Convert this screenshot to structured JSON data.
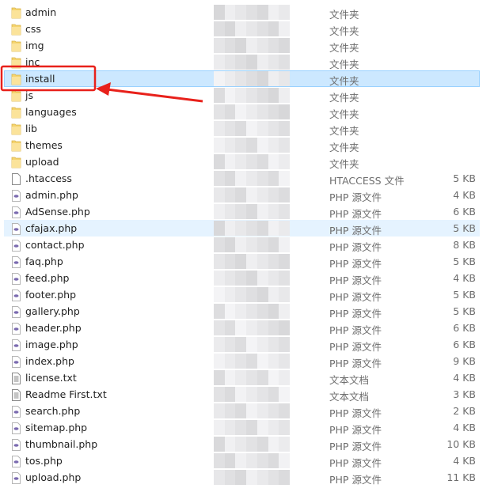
{
  "files": [
    {
      "name": "admin",
      "type": "文件夹",
      "size": "",
      "kind": "folder"
    },
    {
      "name": "css",
      "type": "文件夹",
      "size": "",
      "kind": "folder"
    },
    {
      "name": "img",
      "type": "文件夹",
      "size": "",
      "kind": "folder"
    },
    {
      "name": "inc",
      "type": "文件夹",
      "size": "",
      "kind": "folder"
    },
    {
      "name": "install",
      "type": "文件夹",
      "size": "",
      "kind": "folder",
      "state": "selected"
    },
    {
      "name": "js",
      "type": "文件夹",
      "size": "",
      "kind": "folder"
    },
    {
      "name": "languages",
      "type": "文件夹",
      "size": "",
      "kind": "folder"
    },
    {
      "name": "lib",
      "type": "文件夹",
      "size": "",
      "kind": "folder"
    },
    {
      "name": "themes",
      "type": "文件夹",
      "size": "",
      "kind": "folder"
    },
    {
      "name": "upload",
      "type": "文件夹",
      "size": "",
      "kind": "folder"
    },
    {
      "name": ".htaccess",
      "type": "HTACCESS 文件",
      "size": "5 KB",
      "kind": "blank"
    },
    {
      "name": "admin.php",
      "type": "PHP 源文件",
      "size": "4 KB",
      "kind": "php"
    },
    {
      "name": "AdSense.php",
      "type": "PHP 源文件",
      "size": "6 KB",
      "kind": "php"
    },
    {
      "name": "cfajax.php",
      "type": "PHP 源文件",
      "size": "5 KB",
      "kind": "php",
      "state": "hover"
    },
    {
      "name": "contact.php",
      "type": "PHP 源文件",
      "size": "8 KB",
      "kind": "php"
    },
    {
      "name": "faq.php",
      "type": "PHP 源文件",
      "size": "5 KB",
      "kind": "php"
    },
    {
      "name": "feed.php",
      "type": "PHP 源文件",
      "size": "4 KB",
      "kind": "php"
    },
    {
      "name": "footer.php",
      "type": "PHP 源文件",
      "size": "5 KB",
      "kind": "php"
    },
    {
      "name": "gallery.php",
      "type": "PHP 源文件",
      "size": "5 KB",
      "kind": "php"
    },
    {
      "name": "header.php",
      "type": "PHP 源文件",
      "size": "6 KB",
      "kind": "php"
    },
    {
      "name": "image.php",
      "type": "PHP 源文件",
      "size": "6 KB",
      "kind": "php"
    },
    {
      "name": "index.php",
      "type": "PHP 源文件",
      "size": "9 KB",
      "kind": "php"
    },
    {
      "name": "license.txt",
      "type": "文本文档",
      "size": "4 KB",
      "kind": "txt"
    },
    {
      "name": "Readme First.txt",
      "type": "文本文档",
      "size": "3 KB",
      "kind": "txt"
    },
    {
      "name": "search.php",
      "type": "PHP 源文件",
      "size": "2 KB",
      "kind": "php"
    },
    {
      "name": "sitemap.php",
      "type": "PHP 源文件",
      "size": "4 KB",
      "kind": "php"
    },
    {
      "name": "thumbnail.php",
      "type": "PHP 源文件",
      "size": "10 KB",
      "kind": "php"
    },
    {
      "name": "tos.php",
      "type": "PHP 源文件",
      "size": "4 KB",
      "kind": "php"
    },
    {
      "name": "upload.php",
      "type": "PHP 源文件",
      "size": "11 KB",
      "kind": "php"
    }
  ],
  "colors": {
    "selected": "#cce8ff",
    "hover": "#e5f3ff",
    "annotation": "#e8211b",
    "folder": "#f5d46f"
  }
}
